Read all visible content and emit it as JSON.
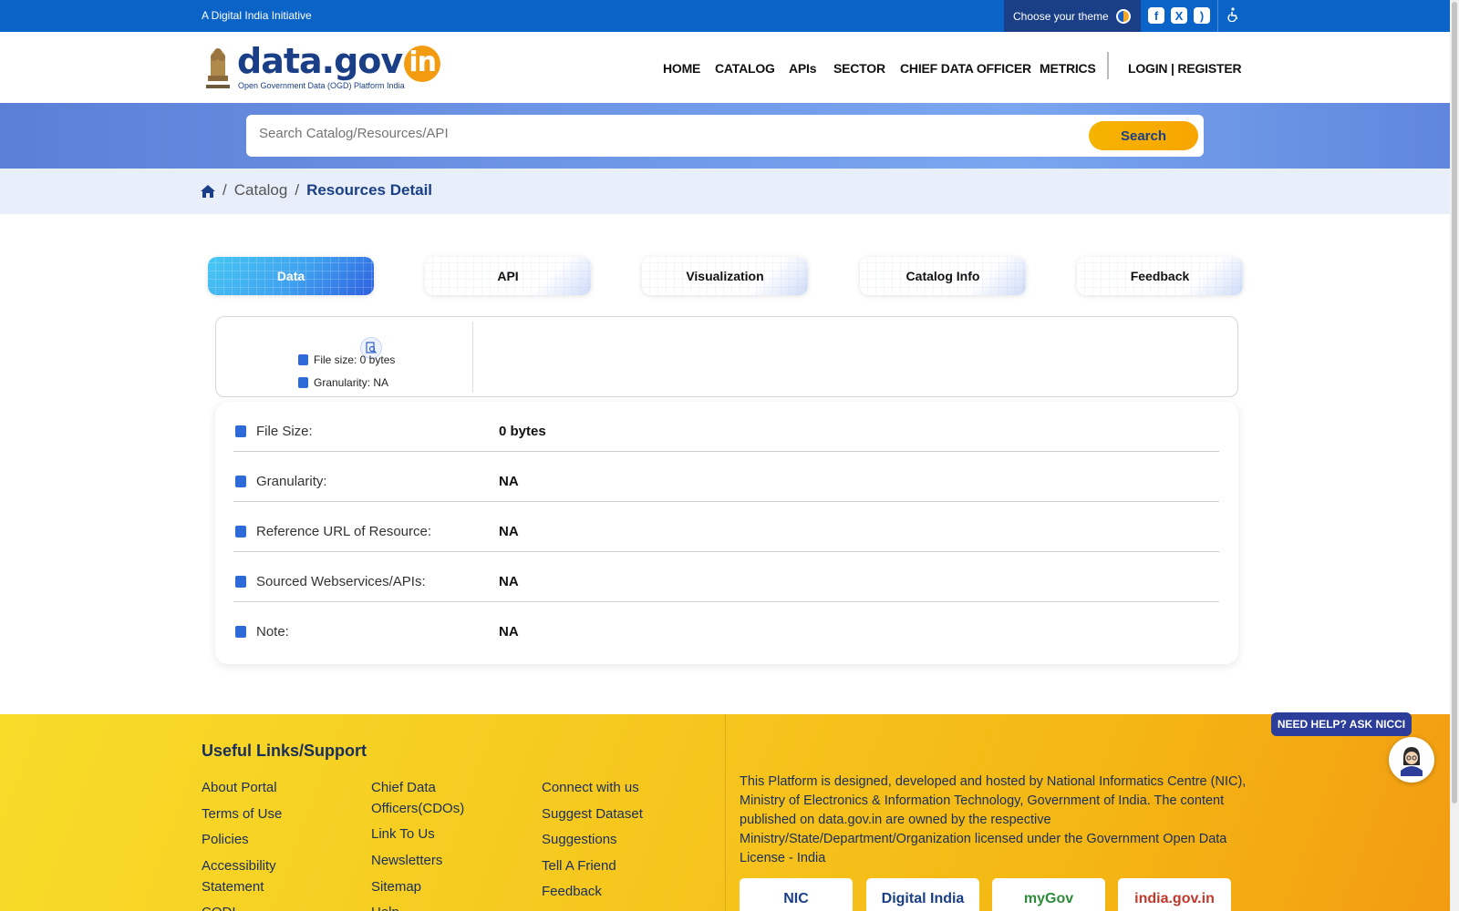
{
  "topbar": {
    "initiative": "A Digital India Initiative",
    "theme_label": "Choose your theme",
    "social": [
      {
        "icon": "facebook-icon",
        "glyph": "f"
      },
      {
        "icon": "x-twitter-icon",
        "glyph": "X"
      },
      {
        "icon": "rss-icon",
        "glyph": ")"
      }
    ],
    "accessibility_icon": "accessibility-icon"
  },
  "header": {
    "logo_text": "data.gov",
    "logo_in": "in",
    "logo_sub": "Open Government Data (OGD) Platform India",
    "nav": [
      "HOME",
      "CATALOG",
      "APIs",
      "SECTOR",
      "CHIEF DATA OFFICER",
      "METRICS"
    ],
    "login": "LOGIN | REGISTER"
  },
  "search": {
    "placeholder": "Search Catalog/Resources/API",
    "button": "Search"
  },
  "breadcrumb": {
    "items": [
      "Catalog"
    ],
    "current": "Resources Detail"
  },
  "tabs": [
    {
      "label": "Data",
      "active": true
    },
    {
      "label": "API",
      "active": false
    },
    {
      "label": "Visualization",
      "active": false
    },
    {
      "label": "Catalog Info",
      "active": false
    },
    {
      "label": "Feedback",
      "active": false
    }
  ],
  "file_card": {
    "file_size": "File size: 0 bytes",
    "granularity": "Granularity: NA"
  },
  "details": [
    {
      "label": "File Size:",
      "value": "0 bytes",
      "icon": "database-icon"
    },
    {
      "label": "Granularity:",
      "value": "NA",
      "icon": "puzzle-icon"
    },
    {
      "label": "Reference URL of Resource:",
      "value": "NA",
      "icon": "folder-open-icon"
    },
    {
      "label": "Sourced Webservices/APIs:",
      "value": "NA",
      "icon": "document-icon"
    },
    {
      "label": "Note:",
      "value": "NA",
      "icon": "file-icon"
    }
  ],
  "footer": {
    "title": "Useful Links/Support",
    "col1": [
      "About Portal",
      "Terms of Use",
      "Policies",
      "Accessibility Statement",
      "CODI"
    ],
    "col2": [
      "Chief Data Officers(CDOs)",
      "Link To Us",
      "Newsletters",
      "Sitemap",
      "Help"
    ],
    "col3": [
      "Connect with us",
      "Suggest Dataset",
      "Suggestions",
      "Tell A Friend",
      "Feedback"
    ],
    "about": "This Platform is designed, developed and hosted by National Informatics Centre (NIC), Ministry of Electronics & Information Technology, Government of India. The content published on data.gov.in are owned by the respective Ministry/State/Department/Organization licensed under the Government Open Data License - India",
    "partners": [
      "NIC",
      "Digital India",
      "myGov",
      "india.gov.in"
    ]
  },
  "help": {
    "badge": "NEED HELP? ASK NICCI"
  },
  "colors": {
    "primary": "#0a64c8",
    "navy": "#1a3f86",
    "accent": "#f5b400"
  }
}
